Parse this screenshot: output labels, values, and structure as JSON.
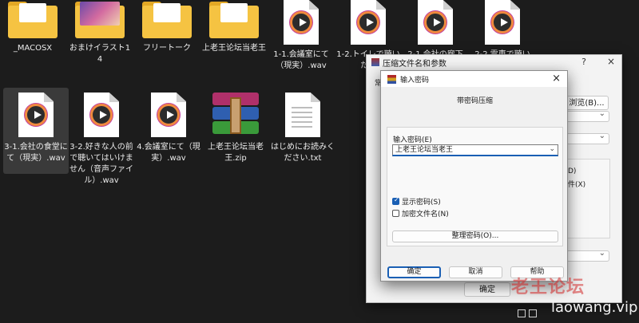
{
  "files_row1": [
    {
      "name": "_MACOSX",
      "type": "folder"
    },
    {
      "name": "おまけイラスト14",
      "type": "folder-pic"
    },
    {
      "name": "フリートーク",
      "type": "folder-doc"
    },
    {
      "name": "上老王论坛当老王",
      "type": "folder"
    },
    {
      "name": "1-1.会議室にて（現実）.wav",
      "type": "wav"
    },
    {
      "name": "1-2.トイレで聴いたら",
      "type": "wav"
    },
    {
      "name": "2-1.会社の廊下",
      "type": "wav"
    },
    {
      "name": "2-2.電車で聴い",
      "type": "wav"
    }
  ],
  "files_row2": [
    {
      "name": "3-1.会社の食堂にて（現実）.wav",
      "type": "wav",
      "selected": true
    },
    {
      "name": "3-2.好きな人の前で聴いてはいけません（音声ファイル）.wav",
      "type": "wav"
    },
    {
      "name": "4.会議室にて（現実）.wav",
      "type": "wav"
    },
    {
      "name": "上老王论坛当老王.zip",
      "type": "zip"
    },
    {
      "name": "はじめにお読みください.txt",
      "type": "txt"
    }
  ],
  "back_window": {
    "title": "压缩文件名和参数",
    "help": "?",
    "close": "×",
    "browse_button": "浏览(B)...",
    "ok_button": "确定",
    "frag_left": "常",
    "frag_d": "D)",
    "frag_x": "件(X)"
  },
  "dialog": {
    "title": "输入密码",
    "close": "×",
    "heading": "带密码压缩",
    "password_label": "输入密码(E)",
    "password_value": "上老王论坛当老王",
    "show_password": "显示密码(S)",
    "show_password_checked": true,
    "encrypt_names": "加密文件名(N)",
    "encrypt_names_checked": false,
    "organize_button": "整理密码(O)...",
    "ok_button": "确定",
    "cancel_button": "取消",
    "help_button": "帮助"
  },
  "watermark": {
    "cn": "老王论坛",
    "url": "laowang.vip"
  },
  "colors": {
    "accent": "#1a5fb4",
    "folder": "#f5c342",
    "background": "#1c1c1c"
  }
}
